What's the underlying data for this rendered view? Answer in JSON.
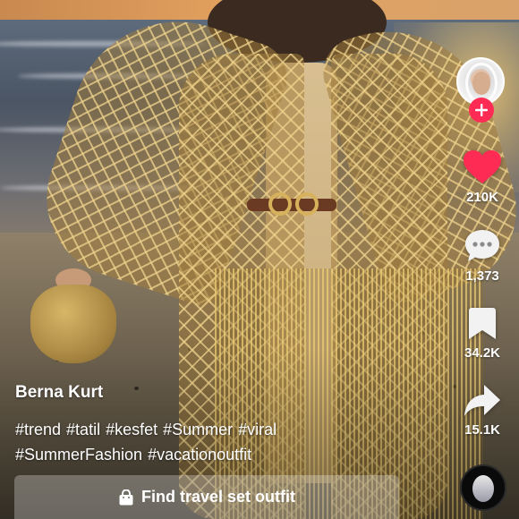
{
  "creator": {
    "username": "Berna Kurt",
    "avatar_icon": "creator-avatar",
    "follow_icon": "plus-icon"
  },
  "actions": {
    "like": {
      "icon": "heart-icon",
      "count": "210K",
      "color": "#fe2c55"
    },
    "comment": {
      "icon": "comment-bubble-icon",
      "count": "1,373"
    },
    "save": {
      "icon": "bookmark-icon",
      "count": "34.2K"
    },
    "share": {
      "icon": "share-arrow-icon",
      "count": "15.1K"
    }
  },
  "caption": {
    "hashtags": [
      "#trend",
      "#tatil",
      "#kesfet",
      "#Summer",
      "#viral",
      "#SummerFashion",
      "#vacationoutfit"
    ]
  },
  "shop": {
    "icon": "shopping-bag-icon",
    "label": "Find travel set outfit"
  },
  "music": {
    "icon": "music-disc-icon"
  },
  "colors": {
    "accent": "#fe2c55",
    "text": "#ffffff"
  }
}
